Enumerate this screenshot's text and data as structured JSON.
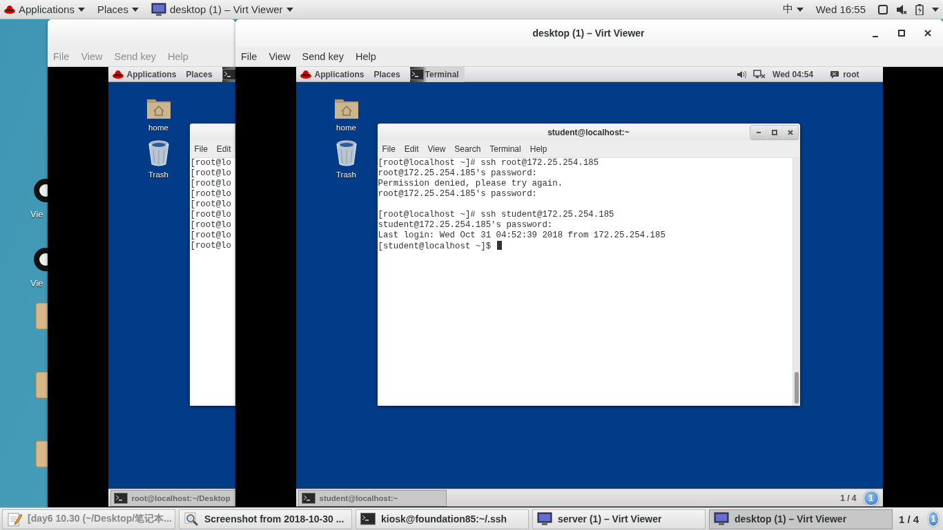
{
  "top_bar": {
    "menus": [
      {
        "label": "Applications"
      },
      {
        "label": "Places"
      }
    ],
    "active_app": "desktop (1) – Virt Viewer",
    "input_method": "中",
    "clock": "Wed 16:55"
  },
  "desktop_icons": [
    {
      "kind": "viewer",
      "label": "Vie"
    },
    {
      "kind": "viewer",
      "label": "Vie"
    },
    {
      "kind": "document"
    },
    {
      "kind": "document"
    },
    {
      "kind": "document"
    }
  ],
  "windows": [
    {
      "focused": false,
      "menu": [
        "File",
        "View",
        "Send key",
        "Help"
      ],
      "guest": {
        "top_bar": {
          "menus": [
            "Applications",
            "Places"
          ],
          "task": {
            "kind": "terminal"
          }
        },
        "desktop_icons": [
          {
            "kind": "home",
            "label": "home"
          },
          {
            "kind": "trash",
            "label": "Trash"
          }
        ],
        "terminal": {
          "menu": [
            "File",
            "Edit"
          ],
          "paragraphs": [
            [
              "[root@lo",
              "[root@lo",
              "[root@lo",
              "[root@lo",
              "[root@lo",
              "[root@lo",
              "[root@lo",
              "[root@lo",
              "[root@lo"
            ]
          ]
        },
        "taskbar": {
          "tasks": [
            {
              "label": "root@localhost:~/Desktop",
              "selected": true
            }
          ]
        }
      }
    },
    {
      "focused": true,
      "title": "desktop (1) – Virt Viewer",
      "menu": [
        "File",
        "View",
        "Send key",
        "Help"
      ],
      "guest": {
        "top_bar": {
          "menus": [
            "Applications",
            "Places"
          ],
          "task": {
            "kind": "terminal",
            "label": "Terminal"
          },
          "clock": "Wed 04:54",
          "user": "root"
        },
        "desktop_icons": [
          {
            "kind": "home",
            "label": "home"
          },
          {
            "kind": "trash",
            "label": "Trash"
          }
        ],
        "terminal": {
          "title": "student@localhost:~",
          "menu": [
            "File",
            "Edit",
            "View",
            "Search",
            "Terminal",
            "Help"
          ],
          "paragraphs": [
            [
              "[root@localhost ~]# ssh root@172.25.254.185",
              "root@172.25.254.185's password:",
              "Permission denied, please try again.",
              "root@172.25.254.185's password:"
            ],
            [
              "[root@localhost ~]# ssh student@172.25.254.185",
              "student@172.25.254.185's password:",
              "Last login: Wed Oct 31 04:52:39 2018 from 172.25.254.185",
              "[student@localhost ~]$"
            ]
          ],
          "cursor": true
        },
        "taskbar": {
          "tasks": [
            {
              "label": "student@localhost:~",
              "selected": true
            }
          ],
          "pager": "1 / 4",
          "notifications": "1"
        }
      }
    }
  ],
  "taskbar": {
    "tasks": [
      {
        "kind": "editor",
        "label": "[day6 10.30 (~/Desktop/笔记本...",
        "selected": false,
        "minimized": true
      },
      {
        "kind": "screenshot",
        "label": "Screenshot from 2018-10-30 ...",
        "selected": false,
        "minimized": false
      },
      {
        "kind": "terminal",
        "label": "kiosk@foundation85:~/.ssh",
        "selected": false,
        "minimized": false
      },
      {
        "kind": "monitor",
        "label": "server (1) – Virt Viewer",
        "selected": false,
        "minimized": false
      },
      {
        "kind": "monitor",
        "label": "desktop (1) – Virt Viewer",
        "selected": true,
        "minimized": false
      }
    ],
    "pager": "1 / 4",
    "notifications": "1"
  }
}
